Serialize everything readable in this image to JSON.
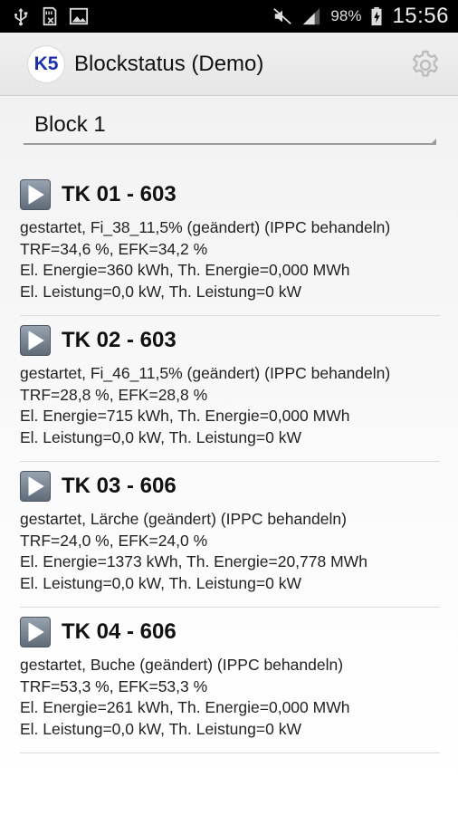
{
  "status_bar": {
    "left_icons": [
      "usb-icon",
      "sd-card-icon",
      "image-icon"
    ],
    "right_icons": [
      "mute-icon",
      "signal-icon"
    ],
    "battery": "98%",
    "time": "15:56"
  },
  "app_bar": {
    "logo": "K5",
    "title": "Blockstatus (Demo)",
    "settings_icon": "gear-icon"
  },
  "block_selector": {
    "value": "Block 1"
  },
  "blocks": [
    {
      "title": "TK 01 - 603",
      "lines": [
        "gestartet, Fi_38_11,5% (geändert) (IPPC behandeln)",
        "TRF=34,6 %, EFK=34,2 %",
        "El. Energie=360 kWh, Th. Energie=0,000 MWh",
        "El. Leistung=0,0 kW, Th. Leistung=0 kW"
      ]
    },
    {
      "title": "TK 02 - 603",
      "lines": [
        "gestartet, Fi_46_11,5% (geändert) (IPPC behandeln)",
        "TRF=28,8 %, EFK=28,8 %",
        "El. Energie=715 kWh, Th. Energie=0,000 MWh",
        "El. Leistung=0,0 kW, Th. Leistung=0 kW"
      ]
    },
    {
      "title": "TK 03 - 606",
      "lines": [
        "gestartet, Lärche (geändert) (IPPC behandeln)",
        "TRF=24,0 %, EFK=24,0 %",
        "El. Energie=1373 kWh, Th. Energie=20,778 MWh",
        "El. Leistung=0,0 kW, Th. Leistung=0 kW"
      ]
    },
    {
      "title": "TK 04 - 606",
      "lines": [
        "gestartet, Buche (geändert) (IPPC behandeln)",
        "TRF=53,3 %, EFK=53,3 %",
        "El. Energie=261 kWh, Th. Energie=0,000 MWh",
        "El. Leistung=0,0 kW, Th. Leistung=0 kW"
      ]
    }
  ]
}
